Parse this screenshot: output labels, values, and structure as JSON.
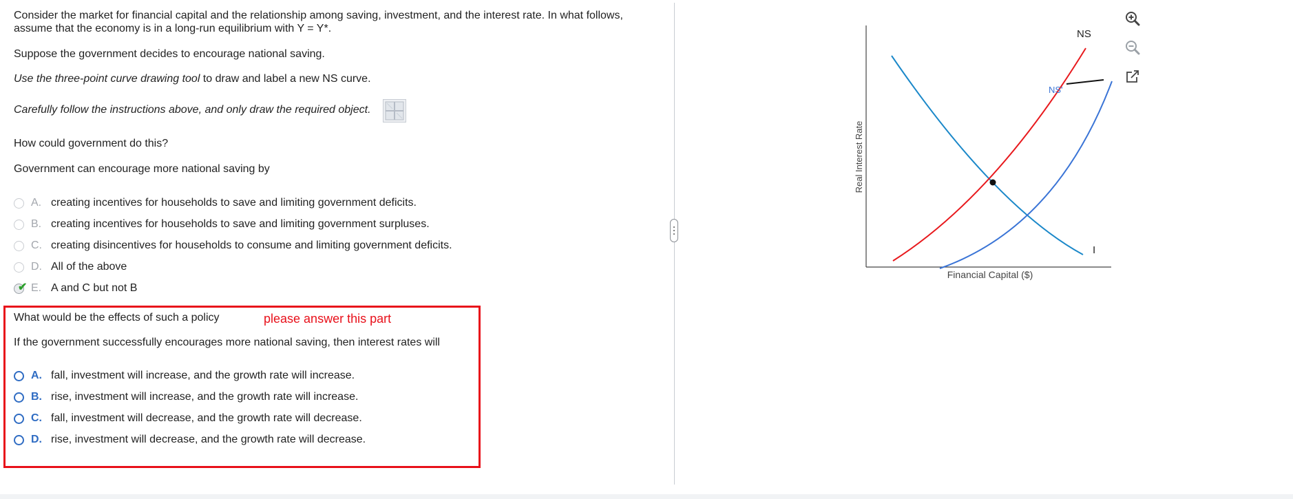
{
  "question": {
    "intro_line1": "Consider the market for financial capital and the relationship among saving, investment, and the interest rate. In what follows,",
    "intro_line2": "assume that the economy is in a long-run equilibrium with Y = Y*.",
    "scenario": "Suppose the government decides to encourage national saving.",
    "instruction_em": "Use the three-point curve drawing tool",
    "instruction_rest": " to draw and label a new NS curve.",
    "caution": "Carefully follow the instructions above, and only draw the required object.",
    "part1_question": "How could government do this?",
    "part1_stem": "Government can encourage more national saving by",
    "part1_options": [
      {
        "letter": "A.",
        "text": "creating incentives for households to save and limiting government deficits."
      },
      {
        "letter": "B.",
        "text": "creating incentives for households to save and limiting government surpluses."
      },
      {
        "letter": "C.",
        "text": "creating disincentives for households to consume and limiting government deficits."
      },
      {
        "letter": "D.",
        "text": "All of the above"
      },
      {
        "letter": "E.",
        "text": "A and C but not B"
      }
    ],
    "part2_question": "What would be the effects of such a policy",
    "part2_annotation": "please answer this part",
    "part2_stem": "If the government successfully encourages more national saving, then interest rates will",
    "part2_options": [
      {
        "letter": "A.",
        "text": "fall, investment will increase, and the growth rate will increase."
      },
      {
        "letter": "B.",
        "text": "rise, investment will increase, and the growth rate will increase."
      },
      {
        "letter": "C.",
        "text": "fall, investment will decrease, and the growth rate will decrease."
      },
      {
        "letter": "D.",
        "text": "rise, investment will decrease, and the growth rate will decrease."
      }
    ]
  },
  "graph": {
    "y_axis_label": "Real Interest Rate",
    "x_axis_label": "Financial Capital ($)",
    "ns_label": "NS",
    "ns_prime_label": "NS'",
    "i_label": "I",
    "colors": {
      "ns": "#e8191d",
      "ns_prime": "#3a74d6",
      "investment": "#1b88c9"
    }
  },
  "toolbar": {
    "icons": [
      "zoom-in-icon",
      "zoom-out-icon",
      "open-external-icon"
    ]
  }
}
